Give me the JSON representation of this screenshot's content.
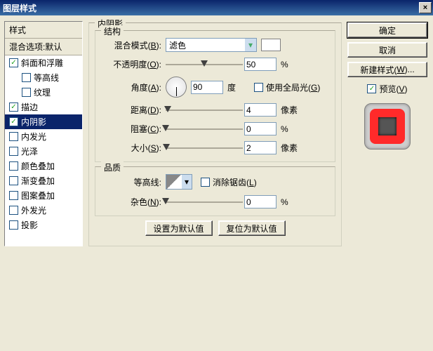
{
  "window": {
    "title": "图层样式",
    "close": "×"
  },
  "sidebar": {
    "header": "样式",
    "blend": "混合选项:默认",
    "items": [
      {
        "label": "斜面和浮雕",
        "checked": true,
        "indent": false
      },
      {
        "label": "等高线",
        "checked": false,
        "indent": true
      },
      {
        "label": "纹理",
        "checked": false,
        "indent": true
      },
      {
        "label": "描边",
        "checked": true,
        "indent": false
      },
      {
        "label": "内阴影",
        "checked": true,
        "indent": false,
        "selected": true
      },
      {
        "label": "内发光",
        "checked": false,
        "indent": false
      },
      {
        "label": "光泽",
        "checked": false,
        "indent": false
      },
      {
        "label": "颜色叠加",
        "checked": false,
        "indent": false
      },
      {
        "label": "渐变叠加",
        "checked": false,
        "indent": false
      },
      {
        "label": "图案叠加",
        "checked": false,
        "indent": false
      },
      {
        "label": "外发光",
        "checked": false,
        "indent": false
      },
      {
        "label": "投影",
        "checked": false,
        "indent": false
      }
    ]
  },
  "panel": {
    "title": "内阴影",
    "structure": {
      "legend": "结构",
      "blendmode_label": "混合模式(B):",
      "blendmode_key": "B",
      "blendmode_value": "滤色",
      "opacity_label": "不透明度(O):",
      "opacity_key": "O",
      "opacity_value": "50",
      "opacity_unit": "%",
      "angle_label": "角度(A):",
      "angle_key": "A",
      "angle_value": "90",
      "angle_unit": "度",
      "global_label": "使用全局光(G)",
      "global_key": "G",
      "global_checked": false,
      "distance_label": "距离(D):",
      "distance_key": "D",
      "distance_value": "4",
      "distance_unit": "像素",
      "choke_label": "阻塞(C):",
      "choke_key": "C",
      "choke_value": "0",
      "choke_unit": "%",
      "size_label": "大小(S):",
      "size_key": "S",
      "size_value": "2",
      "size_unit": "像素"
    },
    "quality": {
      "legend": "品质",
      "contour_label": "等高线:",
      "aa_label": "消除锯齿(L)",
      "aa_key": "L",
      "aa_checked": false,
      "noise_label": "杂色(N):",
      "noise_key": "N",
      "noise_value": "0",
      "noise_unit": "%"
    },
    "buttons": {
      "default": "设置为默认值",
      "reset": "复位为默认值"
    }
  },
  "right": {
    "ok": "确定",
    "cancel": "取消",
    "newstyle": "新建样式(W)...",
    "newstyle_key": "W",
    "preview_label": "预览(V)",
    "preview_key": "V",
    "preview_checked": true
  }
}
